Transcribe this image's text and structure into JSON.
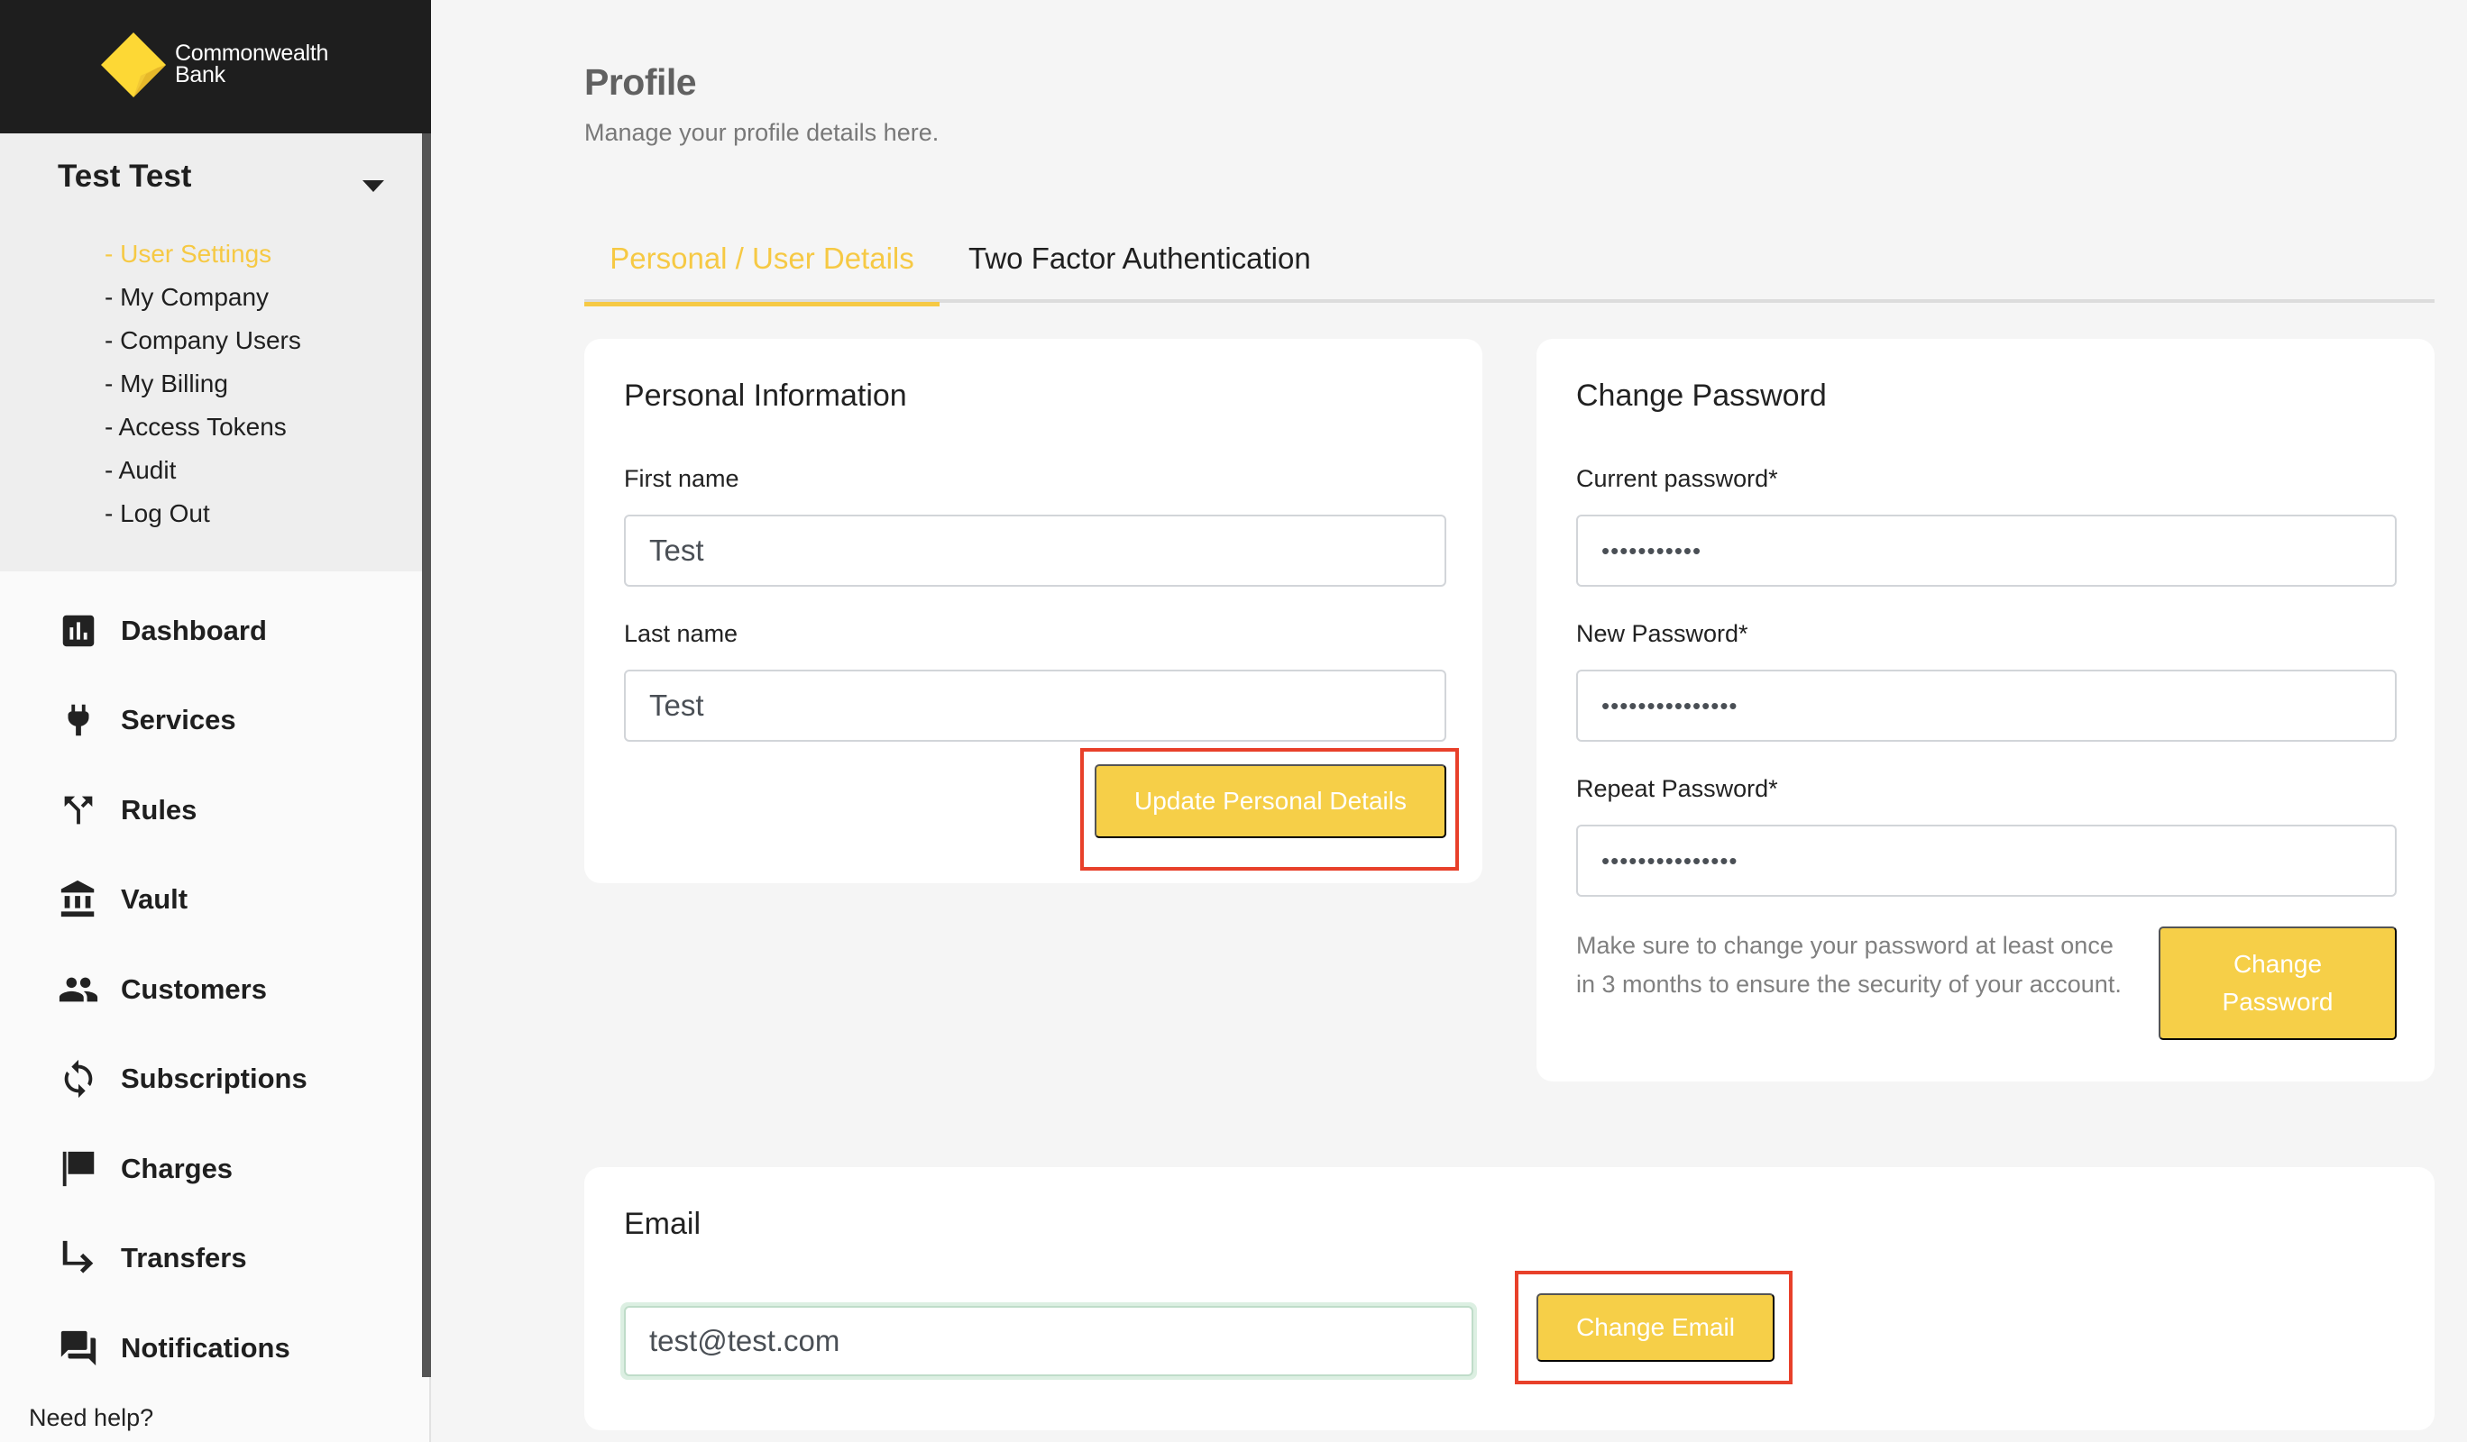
{
  "brand": {
    "name_line1": "Commonwealth",
    "name_line2": "Bank",
    "logo_colors": {
      "primary": "#fdd835",
      "shade": "#e6b82a"
    }
  },
  "user_menu": {
    "name": "Test Test",
    "caret_icon": "caret-down-icon",
    "items": [
      {
        "label": "- User Settings",
        "active": true
      },
      {
        "label": "- My Company",
        "active": false
      },
      {
        "label": "- Company Users",
        "active": false
      },
      {
        "label": "- My Billing",
        "active": false
      },
      {
        "label": "- Access Tokens",
        "active": false
      },
      {
        "label": "- Audit",
        "active": false
      },
      {
        "label": "- Log Out",
        "active": false
      }
    ]
  },
  "nav": {
    "items": [
      {
        "label": "Dashboard",
        "icon": "bar-chart-icon"
      },
      {
        "label": "Services",
        "icon": "plug-icon"
      },
      {
        "label": "Rules",
        "icon": "fork-arrows-icon"
      },
      {
        "label": "Vault",
        "icon": "bank-icon"
      },
      {
        "label": "Customers",
        "icon": "people-icon"
      },
      {
        "label": "Subscriptions",
        "icon": "refresh-icon"
      },
      {
        "label": "Charges",
        "icon": "flag-icon"
      },
      {
        "label": "Transfers",
        "icon": "turn-right-arrow-icon"
      },
      {
        "label": "Notifications",
        "icon": "chat-bubbles-icon"
      }
    ],
    "help_label": "Need help?"
  },
  "page": {
    "title": "Profile",
    "subtitle": "Manage your profile details here."
  },
  "tabs": [
    {
      "label": "Personal / User Details",
      "active": true
    },
    {
      "label": "Two Factor Authentication",
      "active": false
    }
  ],
  "personal_info": {
    "title": "Personal Information",
    "first_name_label": "First name",
    "first_name_value": "Test",
    "last_name_label": "Last name",
    "last_name_value": "Test",
    "submit_label": "Update Personal Details"
  },
  "change_password": {
    "title": "Change Password",
    "current_label": "Current password*",
    "current_value": "•••••••••••",
    "new_label": "New Password*",
    "new_value": "•••••••••••••••",
    "repeat_label": "Repeat Password*",
    "repeat_value": "•••••••••••••••",
    "hint": "Make sure to change your password at least once in 3 months to ensure the security of your account.",
    "submit_label": "Change Password"
  },
  "email": {
    "title": "Email",
    "value": "test@test.com",
    "submit_label": "Change Email"
  },
  "colors": {
    "accent": "#f6c944",
    "button": "#f6cf48",
    "highlight_box": "#e8402a",
    "sidebar_header": "#1e1e1e"
  }
}
